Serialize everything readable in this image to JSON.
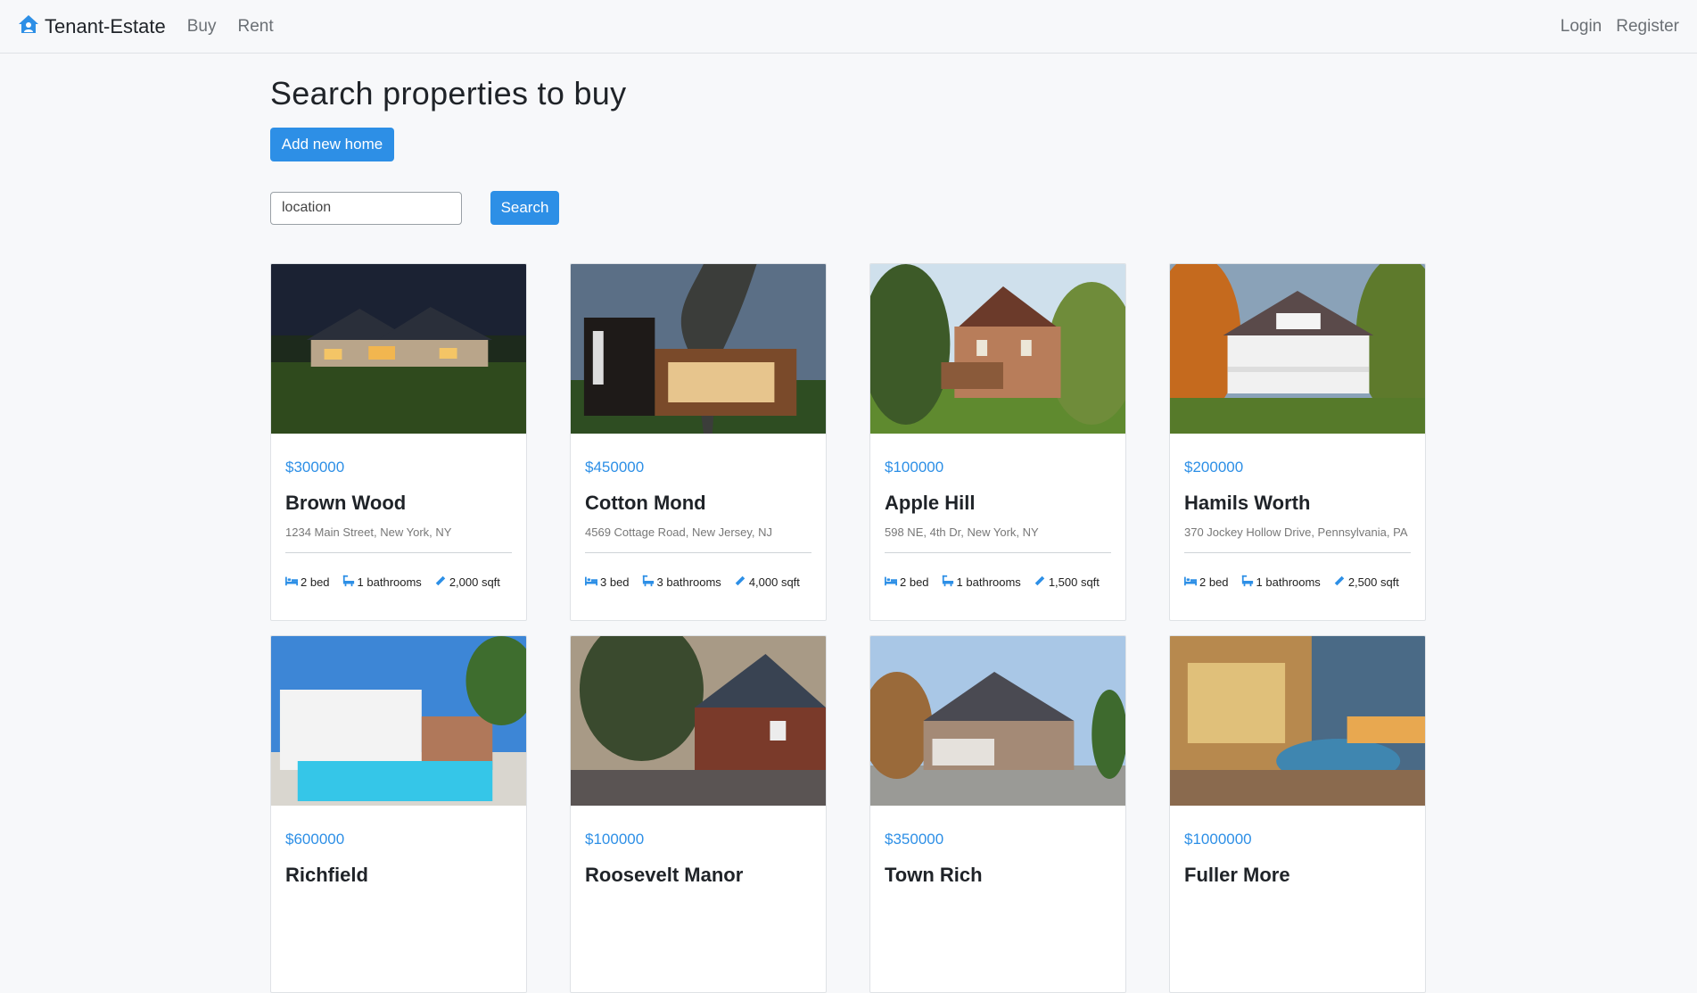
{
  "nav": {
    "brand": "Tenant-Estate",
    "links": [
      "Buy",
      "Rent"
    ],
    "right": [
      "Login",
      "Register"
    ]
  },
  "page": {
    "title": "Search properties to buy",
    "add_button": "Add new home",
    "search_value": "location",
    "search_button": "Search"
  },
  "listings": [
    {
      "price": "$300000",
      "name": "Brown Wood",
      "address": "1234 Main Street, New York, NY",
      "beds": "2 bed",
      "baths": "1 bathrooms",
      "sqft": "2,000 sqft"
    },
    {
      "price": "$450000",
      "name": "Cotton Mond",
      "address": "4569 Cottage Road, New Jersey, NJ",
      "beds": "3 bed",
      "baths": "3 bathrooms",
      "sqft": "4,000 sqft"
    },
    {
      "price": "$100000",
      "name": "Apple Hill",
      "address": "598 NE, 4th Dr, New York, NY",
      "beds": "2 bed",
      "baths": "1 bathrooms",
      "sqft": "1,500 sqft"
    },
    {
      "price": "$200000",
      "name": "Hamils Worth",
      "address": "370 Jockey Hollow Drive, Pennsylvania, PA",
      "beds": "2 bed",
      "baths": "1 bathrooms",
      "sqft": "2,500 sqft"
    },
    {
      "price": "$600000",
      "name": "Richfield",
      "address": "",
      "beds": "",
      "baths": "",
      "sqft": ""
    },
    {
      "price": "$100000",
      "name": "Roosevelt Manor",
      "address": "",
      "beds": "",
      "baths": "",
      "sqft": ""
    },
    {
      "price": "$350000",
      "name": "Town Rich",
      "address": "",
      "beds": "",
      "baths": "",
      "sqft": ""
    },
    {
      "price": "$1000000",
      "name": "Fuller More",
      "address": "",
      "beds": "",
      "baths": "",
      "sqft": ""
    }
  ],
  "colors": {
    "accent": "#2d8fe6"
  },
  "icons": {
    "brand": "house-icon",
    "beds": "bed-icon",
    "baths": "bath-icon",
    "sqft": "ruler-icon"
  }
}
